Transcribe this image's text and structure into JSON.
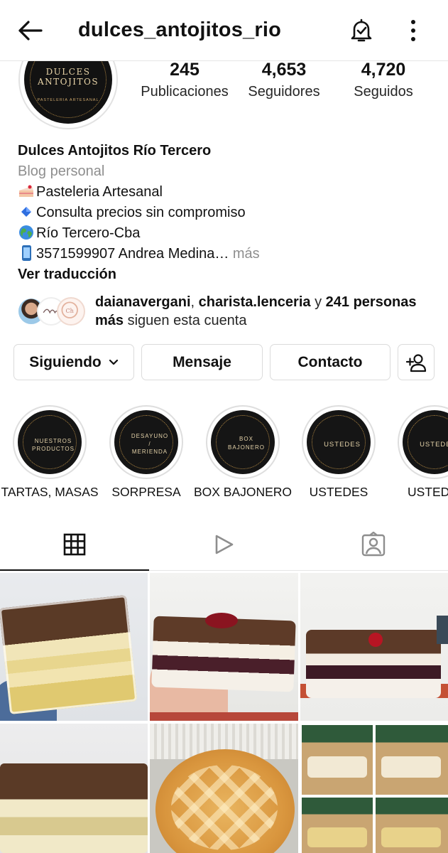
{
  "header": {
    "username": "dulces_antojitos_rio",
    "back_icon": "arrow-left-icon",
    "bell_icon": "bell-check-icon",
    "more_icon": "vertical-dots-icon"
  },
  "avatar": {
    "line1": "DULCES",
    "line2": "ANTOJITOS",
    "line3": "PASTELERIA ARTESANAL"
  },
  "stats": [
    {
      "value": "245",
      "label": "Publicaciones"
    },
    {
      "value": "4,653",
      "label": "Seguidores"
    },
    {
      "value": "4,720",
      "label": "Seguidos"
    }
  ],
  "bio": {
    "name": "Dulces Antojitos Río Tercero",
    "category": "Blog personal",
    "lines": [
      {
        "icon": "cake-slice-icon",
        "text": "Pasteleria Artesanal"
      },
      {
        "icon": "blue-diamond-icon",
        "text": "Consulta precios sin compromiso"
      },
      {
        "icon": "globe-icon",
        "text": "Río Tercero-Cba"
      },
      {
        "icon": "mobile-phone-icon",
        "text": "3571599907 Andrea Medina…"
      }
    ],
    "more": " más",
    "translate": "Ver traducción"
  },
  "followers": {
    "user1": "daianavergani",
    "sep": ", ",
    "user2": "charista.lenceria",
    "and": " y ",
    "count": "241 personas más",
    "suffix": " siguen esta cuenta"
  },
  "buttons": {
    "following": "Siguiendo",
    "message": "Mensaje",
    "contact": "Contacto",
    "add_person_icon": "add-person-icon"
  },
  "highlights": [
    {
      "cover_line1": "NUESTROS",
      "cover_line2": "PRODUCTOS",
      "label": "TARTAS, MASAS"
    },
    {
      "cover_line1": "DESAYUNO",
      "cover_line2": "/",
      "cover_line3": "MERIENDA",
      "label": "SORPRESA"
    },
    {
      "cover_line1": "BOX",
      "cover_line2": "BAJONERO",
      "label": "BOX BAJONERO"
    },
    {
      "cover_line1": "USTEDES",
      "label": "USTEDES"
    },
    {
      "cover_line1": "USTEDES",
      "label": "USTEDES"
    }
  ],
  "tabs": [
    {
      "icon": "grid-icon",
      "active": true
    },
    {
      "icon": "reels-play-icon",
      "active": false
    },
    {
      "icon": "tagged-person-icon",
      "active": false
    }
  ],
  "colors": {
    "text": "#111111",
    "secondary": "#8e8e8e",
    "border": "#dbdbdb",
    "highlight_gold": "#b58a44"
  }
}
